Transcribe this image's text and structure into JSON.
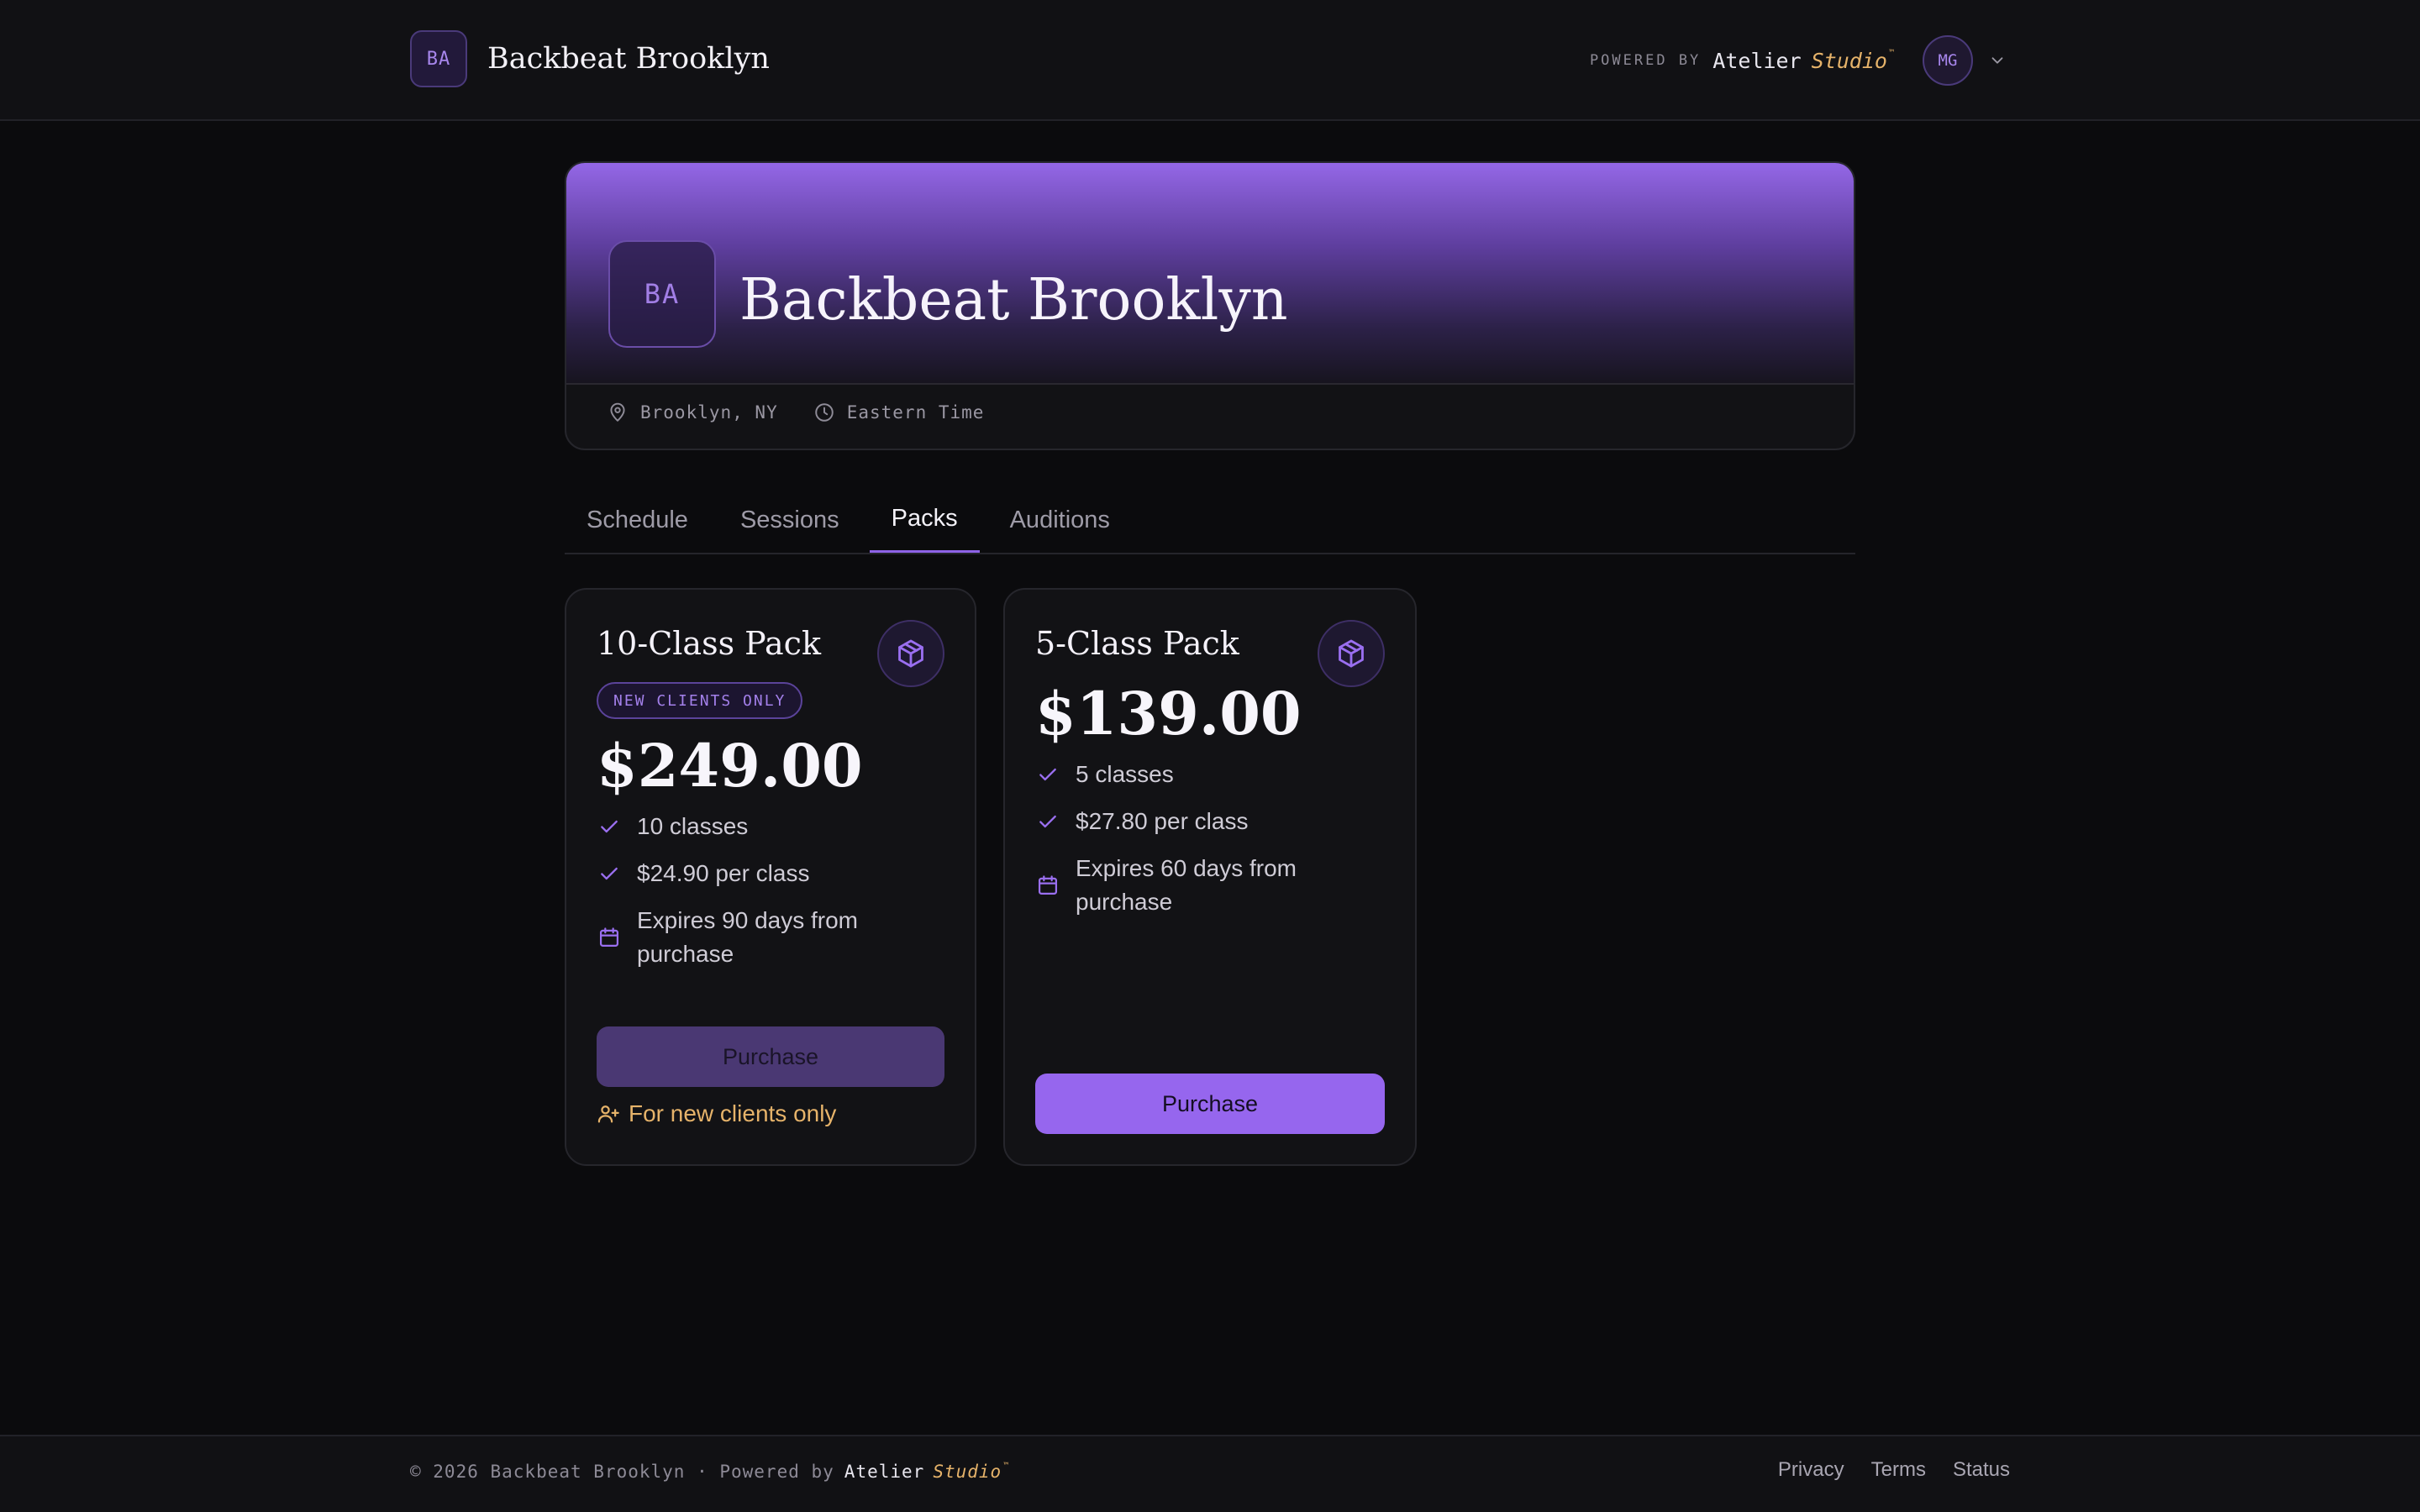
{
  "header": {
    "badge": "BA",
    "brand": "Backbeat Brooklyn",
    "powered_by": "POWERED BY",
    "atelier": "Atelier",
    "studio": "Studio",
    "tm": "™",
    "avatar": "MG"
  },
  "hero": {
    "badge": "BA",
    "title": "Backbeat Brooklyn",
    "location": "Brooklyn, NY",
    "timezone": "Eastern Time"
  },
  "tabs": [
    {
      "label": "Schedule"
    },
    {
      "label": "Sessions"
    },
    {
      "label": "Packs"
    },
    {
      "label": "Auditions"
    }
  ],
  "active_tab": "Packs",
  "packs": [
    {
      "title": "10-Class Pack",
      "badge": "NEW CLIENTS ONLY",
      "price": "$249.00",
      "features": [
        "10 classes",
        "$24.90 per class",
        "Expires 90 days from purchase"
      ],
      "button": "Purchase",
      "button_disabled": true,
      "note": "For new clients only"
    },
    {
      "title": "5-Class Pack",
      "price": "$139.00",
      "features": [
        "5 classes",
        "$27.80 per class",
        "Expires 60 days from purchase"
      ],
      "button": "Purchase",
      "button_disabled": false
    }
  ],
  "footer": {
    "copyright": "© 2026 Backbeat Brooklyn · Powered by",
    "atelier": "Atelier",
    "studio": "Studio",
    "tm": "™",
    "links": [
      "Privacy",
      "Terms",
      "Status"
    ]
  },
  "colors": {
    "accent": "#9666ee",
    "accent_muted": "#4a3873",
    "gold": "#e6b36a",
    "background": "#0b0b0d",
    "surface": "#121215"
  },
  "icons": {
    "pack": "package-cube-icon",
    "check": "check-icon",
    "expiry": "calendar-icon",
    "location": "map-pin-icon",
    "timezone": "clock-icon",
    "note": "user-plus-icon",
    "menu": "chevron-down-icon"
  }
}
